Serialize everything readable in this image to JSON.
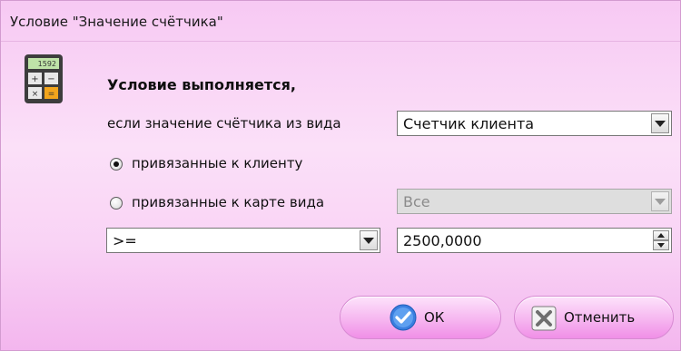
{
  "window": {
    "title": "Условие \"Значение счётчика\""
  },
  "content": {
    "heading": "Условие выполняется,",
    "counter_type_label": "если значение счётчика из вида",
    "counter_type_select": "Счетчик клиента",
    "radio_client_label": "привязанные к клиенту",
    "radio_card_label": "привязанные к карте вида",
    "radio_selected": "client",
    "card_type_select": "Все",
    "operator_select": ">=",
    "value_input": "2500,0000"
  },
  "buttons": {
    "ok_label": "ОК",
    "cancel_label": "Отменить"
  },
  "colors": {
    "window_bg": "#f9d3f5",
    "button_pink": "#f08fe7",
    "ok_icon": "#3a7fe0",
    "cancel_icon": "#6f6f6f"
  }
}
